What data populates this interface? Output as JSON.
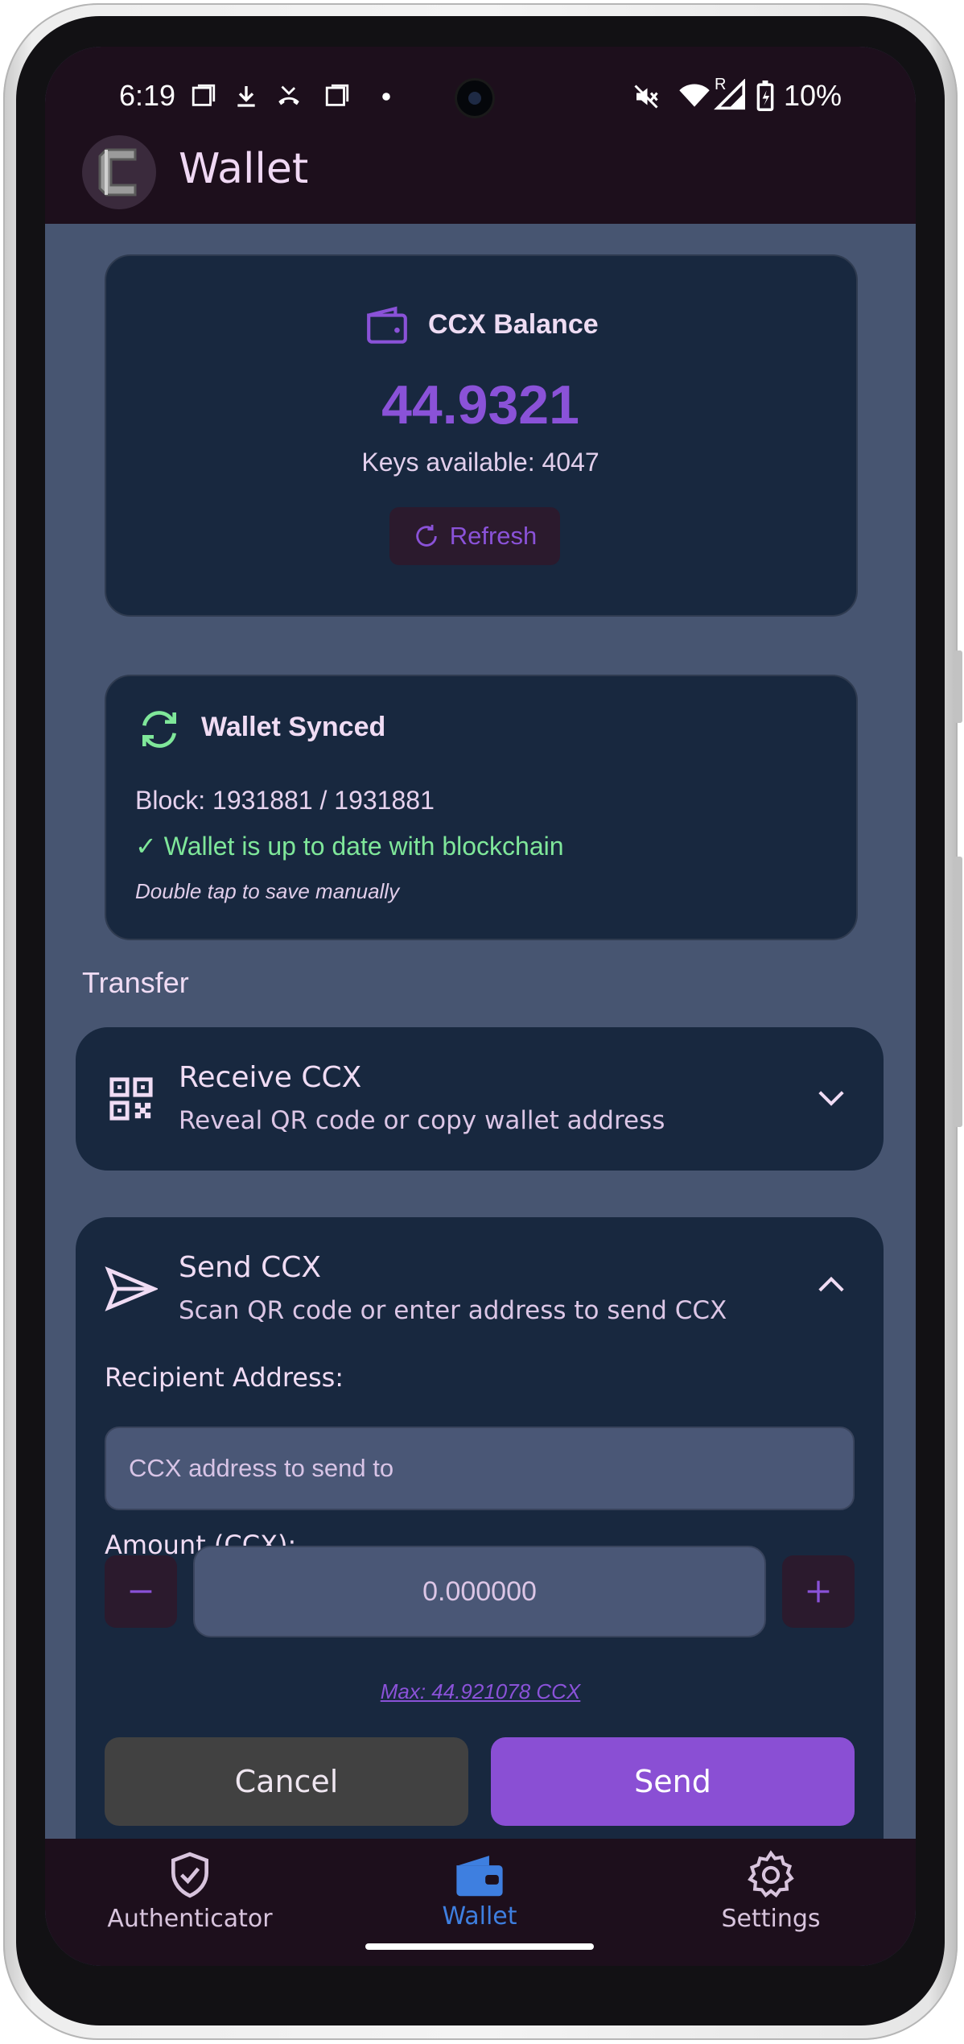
{
  "status_bar": {
    "time": "6:19",
    "battery": "10%",
    "icons": [
      "screenshot-icon",
      "download-icon",
      "missed-call-icon",
      "screenshot-icon",
      "dot-icon",
      "mute-icon",
      "wifi-icon",
      "signal-icon",
      "battery-icon"
    ],
    "signal_label": "R"
  },
  "app_bar": {
    "title": "Wallet",
    "logo_letter": "C"
  },
  "balance_card": {
    "label": "CCX Balance",
    "value": "44.9321",
    "keys_available": "Keys available: 4047",
    "refresh_label": "Refresh"
  },
  "sync_card": {
    "title": "Wallet Synced",
    "block": "Block: 1931881 / 1931881",
    "status": "✓ Wallet is up to date with blockchain",
    "hint": "Double tap to save manually"
  },
  "transfer": {
    "heading": "Transfer",
    "receive": {
      "title": "Receive CCX",
      "subtitle": "Reveal QR code or copy wallet address"
    },
    "send": {
      "title": "Send CCX",
      "subtitle": "Scan QR code or enter address to send CCX",
      "recipient_label": "Recipient Address:",
      "recipient_placeholder": "CCX address to send to",
      "recipient_value": "",
      "amount_label": "Amount (CCX):",
      "amount_value": "0.000000",
      "max_label": "Max: 44.921078 CCX",
      "cancel_label": "Cancel",
      "send_label": "Send"
    }
  },
  "bottom_nav": {
    "items": [
      {
        "label": "Authenticator",
        "icon": "shield-check-icon",
        "active": false
      },
      {
        "label": "Wallet",
        "icon": "wallet-icon",
        "active": true
      },
      {
        "label": "Settings",
        "icon": "gear-icon",
        "active": false
      }
    ]
  },
  "colors": {
    "accent": "#8a52d8",
    "active_nav": "#3e7fe0",
    "success": "#7fe79a",
    "card_bg": "#18283f",
    "screen_bg": "#475571",
    "bar_bg": "#1d0f1c"
  }
}
